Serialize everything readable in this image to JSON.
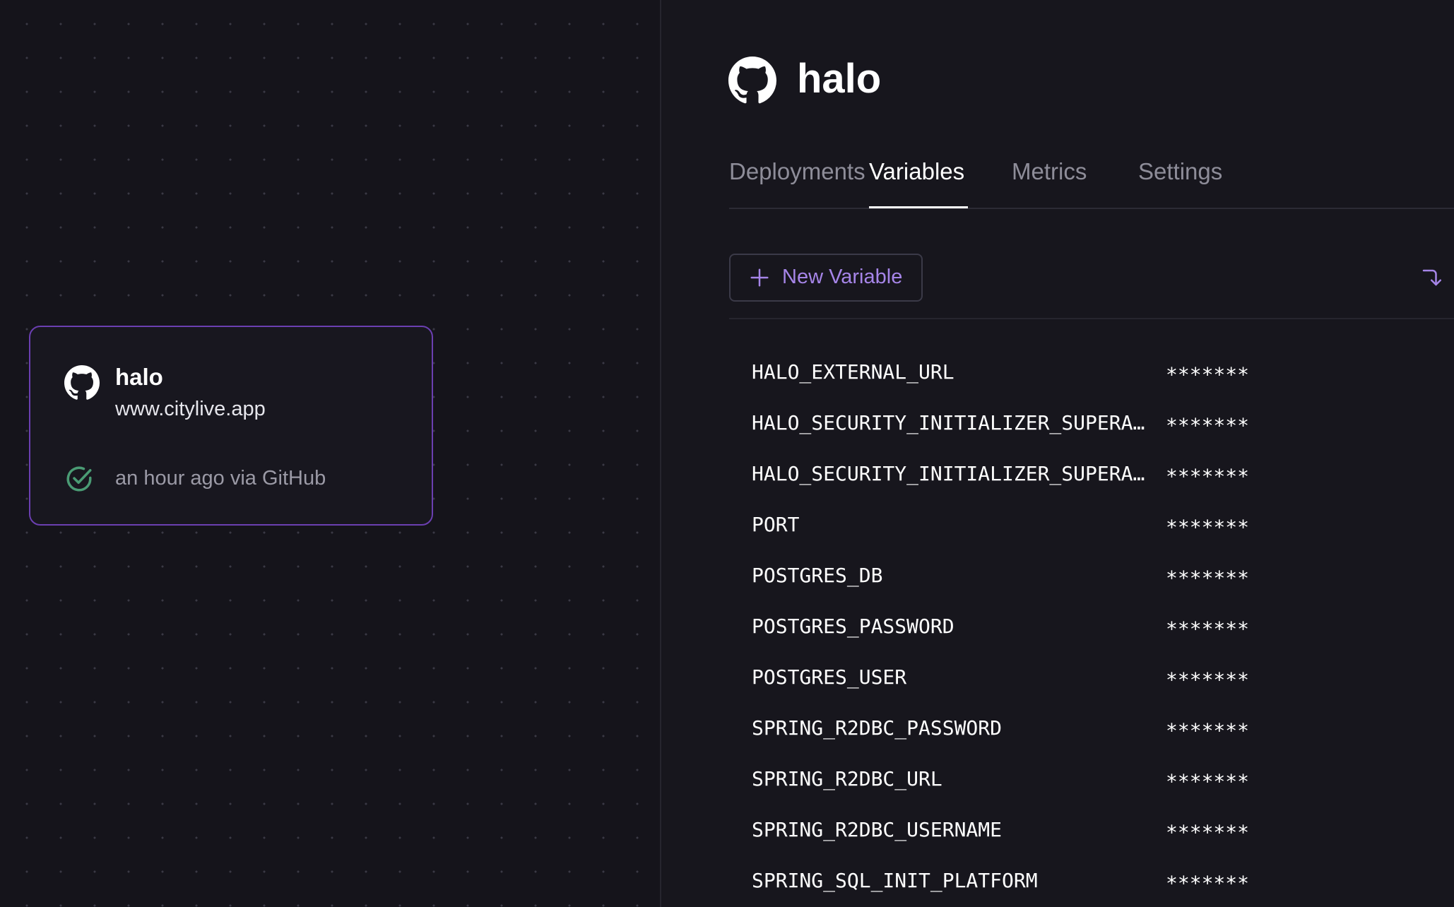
{
  "service_card": {
    "name": "halo",
    "domain": "www.citylive.app",
    "status_text": "an hour ago via GitHub",
    "border_color": "#6b3fb1",
    "status_icon": "check-circle-icon",
    "status_color": "#4a9b74"
  },
  "panel": {
    "title": "halo",
    "source_icon": "github-icon",
    "tabs": [
      {
        "label": "Deployments",
        "active": false
      },
      {
        "label": "Variables",
        "active": true
      },
      {
        "label": "Metrics",
        "active": false
      },
      {
        "label": "Settings",
        "active": false
      }
    ],
    "new_variable_label": "New Variable",
    "accent_color": "#a685e8",
    "variables": [
      {
        "name": "HALO_EXTERNAL_URL",
        "value": "*******"
      },
      {
        "name": "HALO_SECURITY_INITIALIZER_SUPERA…",
        "value": "*******"
      },
      {
        "name": "HALO_SECURITY_INITIALIZER_SUPERA…",
        "value": "*******"
      },
      {
        "name": "PORT",
        "value": "*******"
      },
      {
        "name": "POSTGRES_DB",
        "value": "*******"
      },
      {
        "name": "POSTGRES_PASSWORD",
        "value": "*******"
      },
      {
        "name": "POSTGRES_USER",
        "value": "*******"
      },
      {
        "name": "SPRING_R2DBC_PASSWORD",
        "value": "*******"
      },
      {
        "name": "SPRING_R2DBC_URL",
        "value": "*******"
      },
      {
        "name": "SPRING_R2DBC_USERNAME",
        "value": "*******"
      },
      {
        "name": "SPRING_SQL_INIT_PLATFORM",
        "value": "*******"
      }
    ]
  }
}
